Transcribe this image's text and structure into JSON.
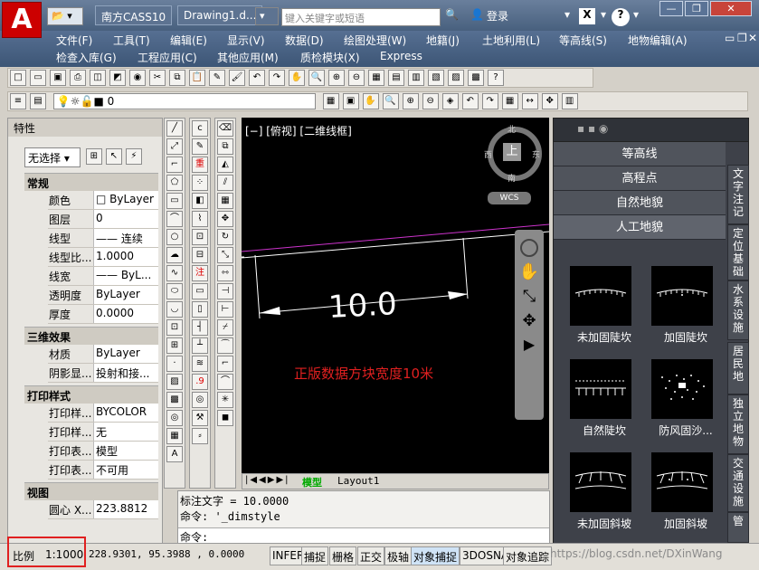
{
  "titlebar": {
    "logo": "A",
    "tabs": [
      "南方CASS10",
      "Drawing1.d..."
    ],
    "search_placeholder": "键入关键字或短语",
    "login": "登录",
    "window_buttons": [
      "—",
      "❐",
      "✕"
    ]
  },
  "menus": {
    "row1": [
      "文件(F)",
      "工具(T)",
      "编辑(E)",
      "显示(V)",
      "数据(D)",
      "绘图处理(W)",
      "地籍(J)",
      "土地利用(L)",
      "等高线(S)",
      "地物编辑(A)"
    ],
    "row2": [
      "检查入库(G)",
      "工程应用(C)",
      "其他应用(M)",
      "质检模块(X)",
      "Express"
    ]
  },
  "layer_value": "0",
  "properties": {
    "title": "特性",
    "selector": "无选择",
    "sections": [
      {
        "name": "常规",
        "rows": [
          [
            "颜色",
            "□ ByLayer"
          ],
          [
            "图层",
            "0"
          ],
          [
            "线型",
            "—— 连续"
          ],
          [
            "线型比...",
            "1.0000"
          ],
          [
            "线宽",
            "—— ByL..."
          ],
          [
            "透明度",
            "ByLayer"
          ],
          [
            "厚度",
            "0.0000"
          ]
        ]
      },
      {
        "name": "三维效果",
        "rows": [
          [
            "材质",
            "ByLayer"
          ],
          [
            "阴影显...",
            "投射和接..."
          ]
        ]
      },
      {
        "name": "打印样式",
        "rows": [
          [
            "打印样...",
            "BYCOLOR"
          ],
          [
            "打印样...",
            "无"
          ],
          [
            "打印表...",
            "模型"
          ],
          [
            "打印表...",
            "不可用"
          ]
        ]
      },
      {
        "name": "视图",
        "rows": [
          [
            "圆心 X...",
            "223.8812"
          ]
        ]
      }
    ]
  },
  "canvas": {
    "viewport_label": "[−] [俯视] [二维线框]",
    "dimension_text": "10.0",
    "annotation": "正版数据方块宽度10米",
    "compass": {
      "n": "北",
      "s": "南",
      "e": "东",
      "w": "西",
      "center": "上"
    },
    "wcs": "WCS",
    "layout_tabs": [
      "模型",
      "Layout1"
    ]
  },
  "command": {
    "lines": [
      "标注文字 = 10.0000",
      "命令: '_dimstyle"
    ],
    "prompt": "命令:"
  },
  "right_panel": {
    "categories": [
      "等高线",
      "高程点",
      "自然地貌",
      "人工地貌"
    ],
    "symbols": [
      "未加固陡坎",
      "加固陡坎",
      "自然陡坎",
      "防风固沙...",
      "未加固斜坡",
      "加固斜坡"
    ],
    "side_tabs": [
      "文字注记",
      "定位基础",
      "水系设施",
      "居民地",
      "独立地物",
      "交通设施",
      "管"
    ]
  },
  "status": {
    "scale_label": "比例",
    "scale_value": "1:1000",
    "coords": "228.9301, 95.3988 , 0.0000",
    "buttons": [
      "INFER",
      "捕捉",
      "栅格",
      "正交",
      "极轴",
      "对象捕捉",
      "3DOSNAP",
      "对象追踪"
    ],
    "watermark": "https://blog.csdn.net/DXinWang"
  },
  "colors": {
    "annotation": "#e02020",
    "dim": "#ffffff",
    "polyline": "#cc33cc"
  }
}
